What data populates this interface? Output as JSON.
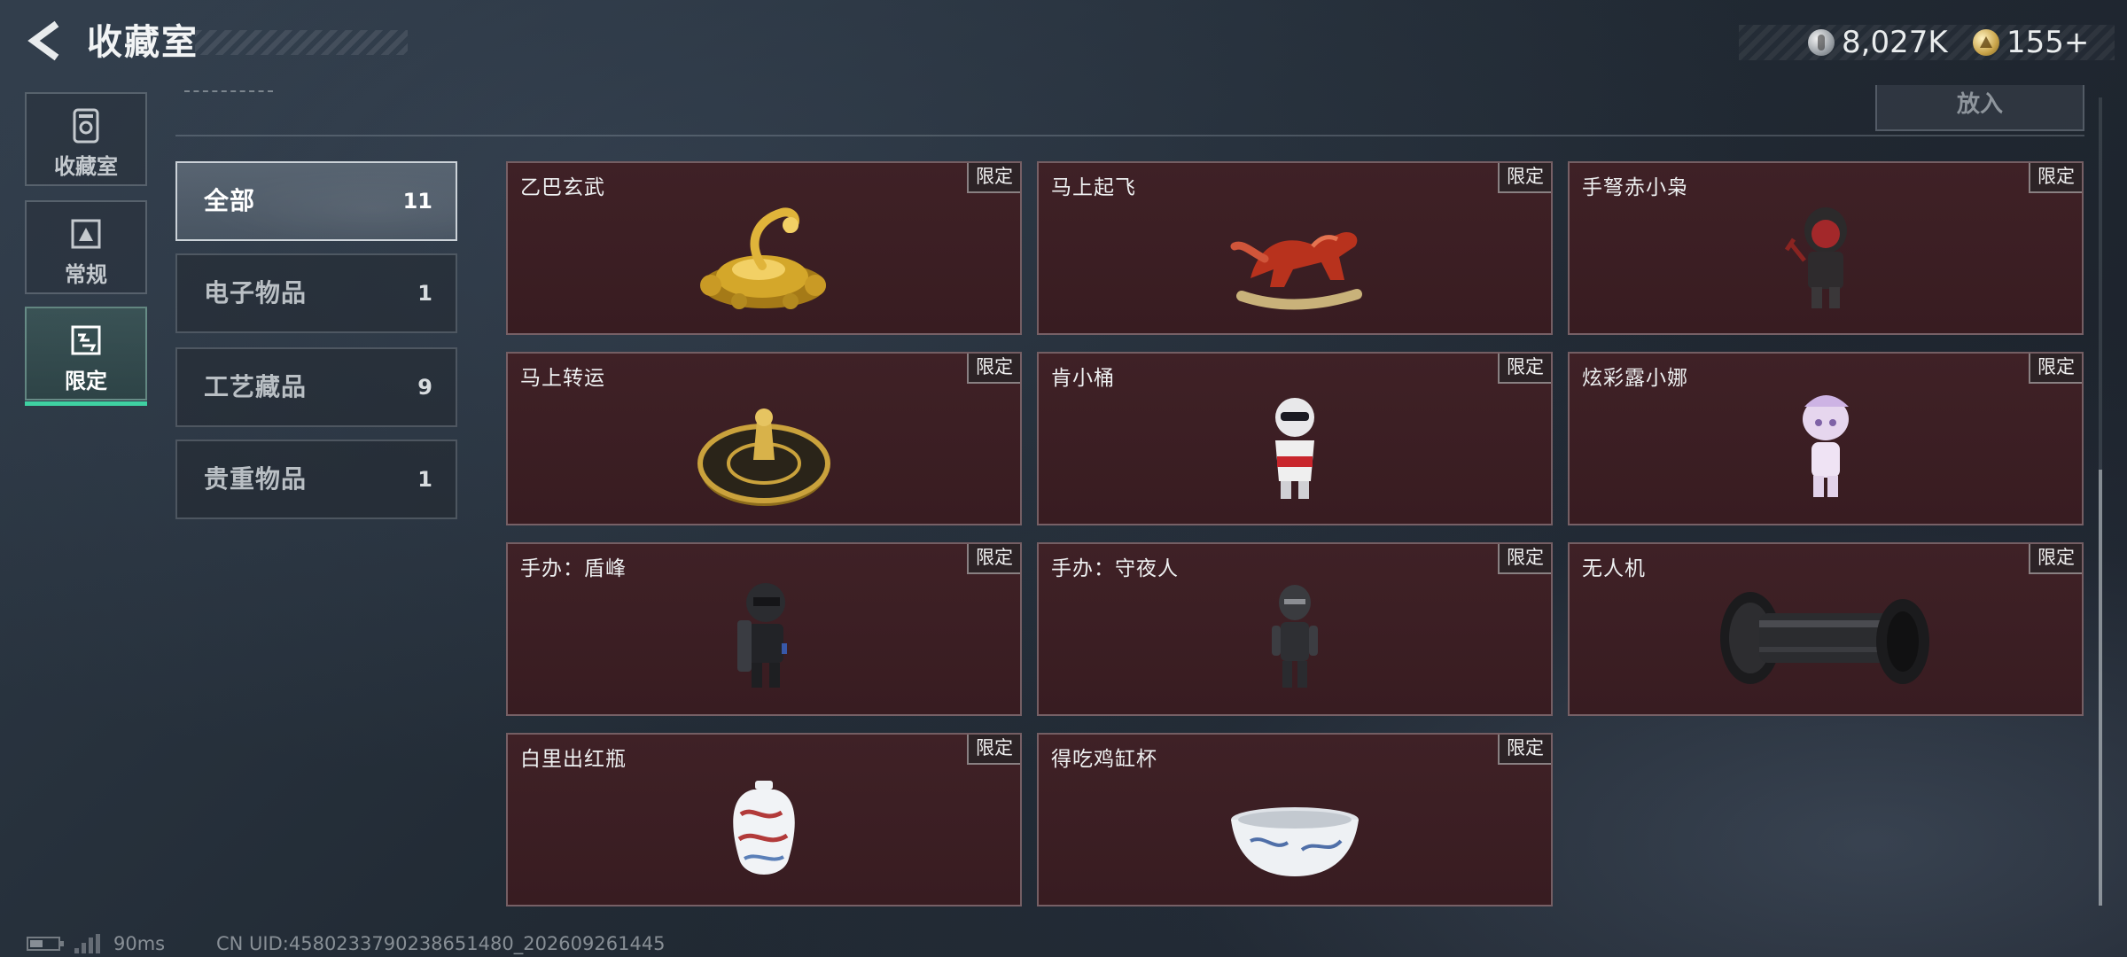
{
  "header": {
    "title": "收藏室",
    "currency_silver": "8,027K",
    "currency_gold": "155+"
  },
  "sidebar": {
    "items": [
      {
        "label": "收藏室",
        "icon": "collection-room-icon",
        "active": false
      },
      {
        "label": "常规",
        "icon": "regular-icon",
        "active": false
      },
      {
        "label": "限定",
        "icon": "limited-icon",
        "active": true
      }
    ]
  },
  "toolbar": {
    "put_in_label": "放入"
  },
  "categories": [
    {
      "name": "全部",
      "count": "11",
      "active": true
    },
    {
      "name": "电子物品",
      "count": "1",
      "active": false
    },
    {
      "name": "工艺藏品",
      "count": "9",
      "active": false
    },
    {
      "name": "贵重物品",
      "count": "1",
      "active": false
    }
  ],
  "items": [
    {
      "name": "乙巴玄武",
      "badge": "限定",
      "icon": "golden-dragon-tortoise-icon"
    },
    {
      "name": "马上起飞",
      "badge": "限定",
      "icon": "red-horse-statue-icon"
    },
    {
      "name": "手弩赤小枭",
      "badge": "限定",
      "icon": "crossbow-figure-icon"
    },
    {
      "name": "马上转运",
      "badge": "限定",
      "icon": "golden-turntable-icon"
    },
    {
      "name": "肯小桶",
      "badge": "限定",
      "icon": "bucket-figure-icon"
    },
    {
      "name": "炫彩露小娜",
      "badge": "限定",
      "icon": "pastel-figure-icon"
    },
    {
      "name": "手办：盾峰",
      "badge": "限定",
      "icon": "shield-soldier-figure-icon"
    },
    {
      "name": "手办：守夜人",
      "badge": "限定",
      "icon": "night-watch-figure-icon"
    },
    {
      "name": "无人机",
      "badge": "限定",
      "icon": "drone-tracked-icon"
    },
    {
      "name": "白里出红瓶",
      "badge": "限定",
      "icon": "porcelain-vase-icon"
    },
    {
      "name": "得吃鸡缸杯",
      "badge": "限定",
      "icon": "porcelain-cup-icon"
    }
  ],
  "footer": {
    "ping": "90ms",
    "uid": "CN UID:4580233790238651480_202609261445"
  },
  "colors": {
    "accent": "#3fd1a2",
    "card_bg": "#3f2126",
    "background": "#222b35"
  }
}
